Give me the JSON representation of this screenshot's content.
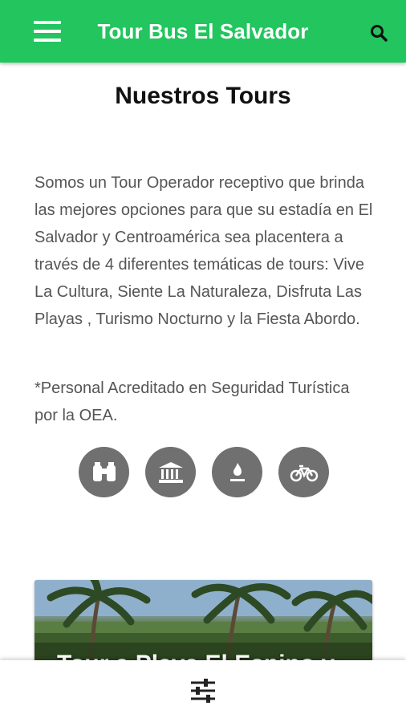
{
  "app_bar": {
    "title": "Tour Bus El Salvador",
    "menu_icon": "hamburger-menu-icon",
    "search_icon": "search-icon",
    "color": "#22c55e"
  },
  "page": {
    "title": "Nuestros Tours",
    "intro": "Somos un Tour Operador receptivo que brinda las mejores opciones para que su estadía en El Salvador y Centroamérica sea placentera a través de 4 diferentes temáticas de tours: Vive La Cultura, Siente La Naturaleza, Disfruta Las Playas , Turismo Nocturno y la Fiesta Abordo.",
    "note": "*Personal Acreditado en Seguridad Turística por la OEA."
  },
  "categories": [
    {
      "icon": "binoculars-icon"
    },
    {
      "icon": "museum-icon"
    },
    {
      "icon": "fire-icon"
    },
    {
      "icon": "bicycle-icon"
    }
  ],
  "card": {
    "title": "Tour a Playa El Espino y"
  },
  "bottom_bar": {
    "filter_icon": "filter-sliders-icon"
  }
}
